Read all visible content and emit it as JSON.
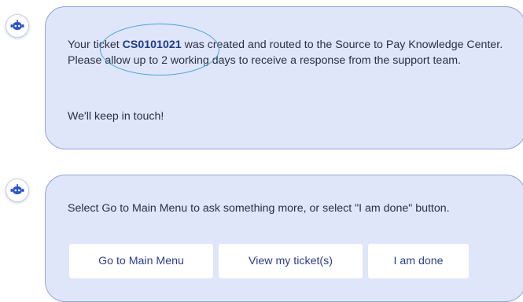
{
  "messages": [
    {
      "text_before": "Your ticket ",
      "ticket_number": "CS0101021",
      "text_after": " was created and routed to the Source to Pay Knowledge Center. Please allow up to 2 working days to receive a response from the support team.",
      "closing": "We'll keep in touch!"
    },
    {
      "text": "Select Go to Main Menu to ask something more, or select \"I am done\" button.",
      "buttons": [
        {
          "label": "Go to Main Menu"
        },
        {
          "label": "View my ticket(s)"
        },
        {
          "label": "I am done"
        }
      ]
    }
  ],
  "icons": {
    "avatar": "bot-avatar-icon"
  },
  "colors": {
    "bubble_bg": "#dfe6f9",
    "bubble_border": "#92a3d6",
    "ticket_link": "#1f3a8a",
    "annotation_ellipse": "#49a3e0",
    "button_text": "#2d3d8c"
  }
}
